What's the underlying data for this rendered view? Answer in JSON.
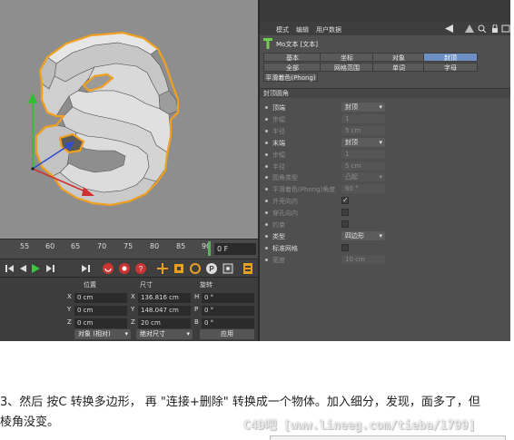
{
  "timeline": {
    "ticks": [
      "55",
      "60",
      "65",
      "70",
      "75",
      "80",
      "85",
      "90"
    ],
    "frame_value": "0 F"
  },
  "coords": {
    "headers": {
      "position": "位置",
      "size": "尺寸",
      "rotation": "旋转"
    },
    "rows": [
      {
        "axis": "X",
        "pos": "0 cm",
        "size_axis": "X",
        "size": "136.816 cm",
        "rot_axis": "H",
        "rot": "0 °"
      },
      {
        "axis": "Y",
        "pos": "0 cm",
        "size_axis": "Y",
        "size": "148.047 cm",
        "rot_axis": "P",
        "rot": "0 °"
      },
      {
        "axis": "Z",
        "pos": "0 cm",
        "size_axis": "Z",
        "size": "20 cm",
        "rot_axis": "B",
        "rot": "0 °"
      }
    ],
    "mode_dropdown": "对象 (相对)",
    "size_dropdown": "绝对尺寸",
    "apply_button": "应用"
  },
  "attr": {
    "menu": [
      "模式",
      "编辑",
      "用户数据"
    ],
    "object_title": "Mo文本 [文本]",
    "tabs_row1": [
      {
        "label": "基本",
        "active": false
      },
      {
        "label": "坐标",
        "active": false
      },
      {
        "label": "对象",
        "active": false
      },
      {
        "label": "封顶",
        "active": true
      }
    ],
    "tabs_row2": [
      {
        "label": "全部",
        "active": false
      },
      {
        "label": "网格范围",
        "active": false
      },
      {
        "label": "单词",
        "active": false
      },
      {
        "label": "字母",
        "active": false
      }
    ],
    "tab_row3": "平滑着色(Phong)",
    "section_title": "封顶圆角",
    "properties": [
      {
        "label": "顶端",
        "value": "封顶",
        "type": "drop",
        "dim": false
      },
      {
        "label": "步幅",
        "value": "1",
        "type": "field",
        "dim": true
      },
      {
        "label": "半径",
        "value": "5 cm",
        "type": "field",
        "dim": true
      },
      {
        "label": "末端",
        "value": "封顶",
        "type": "drop",
        "dim": false
      },
      {
        "label": "步幅",
        "value": "1",
        "type": "field",
        "dim": true
      },
      {
        "label": "半径",
        "value": "5 cm",
        "type": "field",
        "dim": true
      },
      {
        "label": "圆角类型",
        "value": "凸起",
        "type": "drop",
        "dim": true
      },
      {
        "label": "平滑着色(Phong)角度",
        "value": "60 °",
        "type": "field",
        "dim": true
      },
      {
        "label": "外壳向内",
        "value": "✓",
        "type": "check",
        "dim": true
      },
      {
        "label": "穿孔向内",
        "value": "",
        "type": "check",
        "dim": true
      },
      {
        "label": "约束",
        "value": "",
        "type": "check",
        "dim": true
      },
      {
        "label": "类型",
        "value": "四边形",
        "type": "drop",
        "dim": false
      },
      {
        "label": "标准网格",
        "value": "",
        "type": "check",
        "dim": false
      },
      {
        "label": "宽度",
        "value": "10 cm",
        "type": "field",
        "dim": true
      }
    ]
  },
  "caption": {
    "line1": "3、然后 按C 转换多边形， 再 \"连接+删除\" 转换成一个物体。加入细分，发现，面多了，但",
    "line2": "棱角没变。",
    "watermark": "C4D吧 [www.lineeg.com/tieba/1799]"
  },
  "colors": {
    "viewport_bg": "#8e8e8e",
    "selection_outline": "#f0a020",
    "active_tab": "#6c8fc4",
    "panel_bg": "#4f4f4f"
  }
}
